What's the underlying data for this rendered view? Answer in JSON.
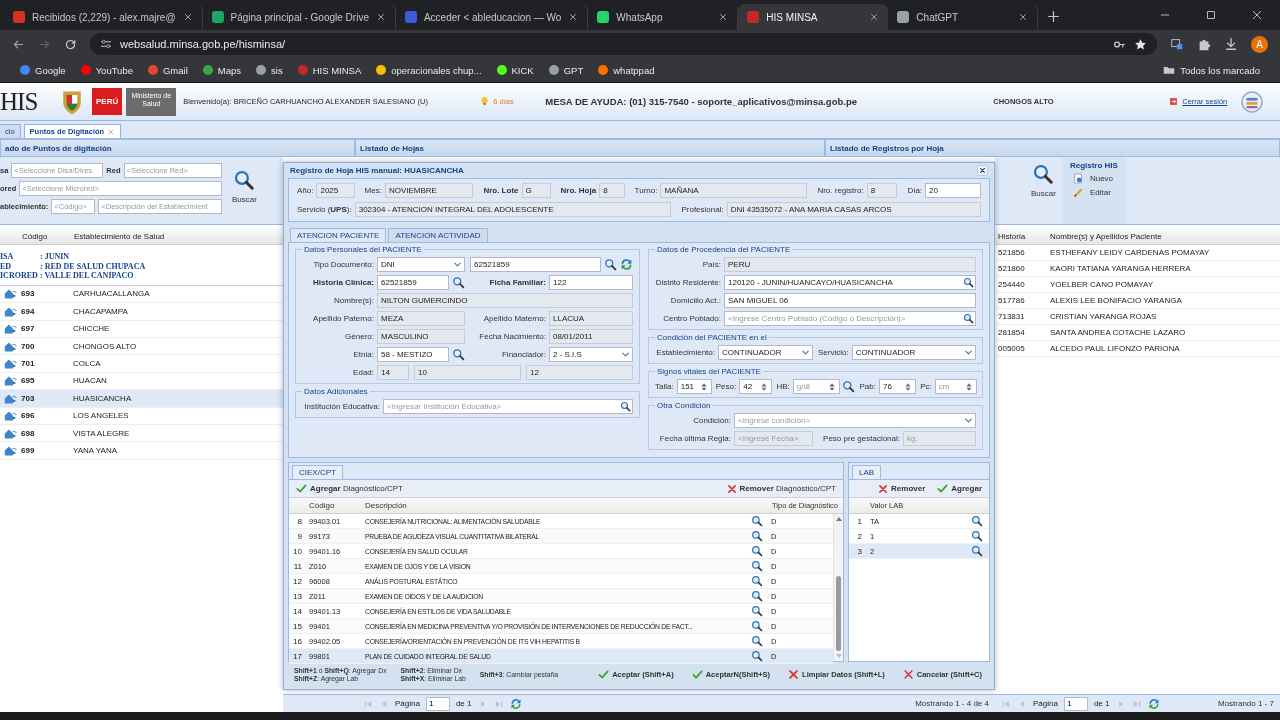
{
  "browser": {
    "tabs": [
      {
        "title": "Recibidos (2,229) - alex.majre@",
        "selected": false
      },
      {
        "title": "Página principal - Google Drive",
        "selected": false
      },
      {
        "title": "Acceder < ableducacion — Wo",
        "selected": false
      },
      {
        "title": "WhatsApp",
        "selected": false
      },
      {
        "title": "HIS MINSA",
        "selected": true
      },
      {
        "title": "ChatGPT",
        "selected": false
      }
    ],
    "url": "websalud.minsa.gob.pe/hisminsa/",
    "profile": "A",
    "bookmarks": [
      "Google",
      "YouTube",
      "Gmail",
      "Maps",
      "sis",
      "HIS MINSA",
      "operacionales chup...",
      "KICK",
      "GPT",
      "whatppad"
    ],
    "all_bookmarks": "Todos los marcado"
  },
  "app": {
    "logo": "HIS",
    "country": "PERÚ",
    "ministry": "Ministerio de Salud",
    "welcome": "Bienvenido(a): BRICEÑO CARHUANCHO ALEXANDER SALESIANO (U)",
    "alert": "6 días",
    "helpdesk": "MESA DE AYUDA: (01) 315-7540 - soporte_aplicativos@minsa.gob.pe",
    "establishment": "CHONGOS ALTO",
    "logout": "Cerrar sesión",
    "tabs": [
      {
        "label": "cio",
        "selected": false,
        "closable": false
      },
      {
        "label": "Puntos de Digitación",
        "selected": true,
        "closable": true
      }
    ],
    "panel_titles": [
      "ado de Puntos de digitación",
      "Listado de Hojas",
      "Listado de Registros por Hoja"
    ]
  },
  "points": {
    "filter_rows": [
      [
        {
          "label": "sa",
          "placeholder": "<Seleccione Disa/Dires."
        },
        {
          "label": "Red",
          "placeholder": "<Seleccione Red>"
        }
      ],
      [
        {
          "label": "ored",
          "placeholder": "<Seleccione Microred>"
        }
      ],
      [
        {
          "label": "ablecimiento:",
          "placeholder": "<Código>"
        },
        {
          "placeholder": "<Descripción del Establecimient"
        }
      ]
    ],
    "search": "Buscar",
    "columns": [
      "Código",
      "Establecimiento de Salud"
    ],
    "group": [
      {
        "label": "ISA",
        "value": ": JUNIN"
      },
      {
        "label": "ED",
        "value": ": RED DE SALUD CHUPACA"
      },
      {
        "label": "ICRORED",
        "value": ": VALLE DEL CANIPACO"
      }
    ],
    "rows": [
      {
        "code": "693",
        "name": "CARHUACALLANGA",
        "selected": false
      },
      {
        "code": "694",
        "name": "CHACAPAMPA",
        "selected": false
      },
      {
        "code": "697",
        "name": "CHICCHE",
        "selected": false
      },
      {
        "code": "700",
        "name": "CHONGOS ALTO",
        "selected": false
      },
      {
        "code": "701",
        "name": "COLCA",
        "selected": false
      },
      {
        "code": "695",
        "name": "HUACAN",
        "selected": false
      },
      {
        "code": "703",
        "name": "HUASICANCHA",
        "selected": true
      },
      {
        "code": "696",
        "name": "LOS ANGELES",
        "selected": false
      },
      {
        "code": "698",
        "name": "VISTA ALEGRE",
        "selected": false
      },
      {
        "code": "699",
        "name": "YANA YANA",
        "selected": false
      }
    ]
  },
  "registros": {
    "search": "Buscar",
    "group_title": "Registro HIS",
    "actions": [
      {
        "label": "Nuevo",
        "kind": "new"
      },
      {
        "label": "Editar",
        "kind": "edit"
      }
    ],
    "columns": [
      "Historia",
      "Nombre(s) y Apellidos Paciente"
    ],
    "rows": [
      {
        "historia": "521856",
        "name": "ESTHEFANY LEIDY CARDENAS POMAYAY"
      },
      {
        "historia": "521860",
        "name": "KAORI TATIANA YARANGA HERRERA"
      },
      {
        "historia": "254440",
        "name": "YOELBER CANO POMAYAY"
      },
      {
        "historia": "517786",
        "name": "ALEXIS LEE BONIFACIO YARANGA"
      },
      {
        "historia": "713831",
        "name": "CRISTIAN YARANGA ROJAS"
      },
      {
        "historia": "281854",
        "name": "SANTA ANDREA COTACHE LAZARO"
      },
      {
        "historia": "005005",
        "name": "ALCEDO PAUL LIFONZO PARIONA"
      }
    ]
  },
  "pagers": [
    {
      "page_label": "Página",
      "page": "1",
      "of": "de 1",
      "summary": "Mostrando 1 - 4 de 4"
    },
    {
      "page_label": "Página",
      "page": "1",
      "of": "de 1",
      "summary": "Mostrando 1 - 7"
    }
  ],
  "modal": {
    "title": "Registro de Hoja HIS manual: HUASICANCHA",
    "header_rows": [
      [
        {
          "label": "Año:",
          "value": "2025",
          "kind": "text",
          "readonly": true
        },
        {
          "label": "Mes:",
          "value": "NOVIEMBRE",
          "kind": "text",
          "readonly": true
        },
        {
          "label": "Nro. Lote",
          "value": "G",
          "kind": "text",
          "readonly": true,
          "bold": true
        },
        {
          "label": "Nro. Hoja",
          "value": "8",
          "kind": "text",
          "readonly": true,
          "bold": true
        },
        {
          "label": "Turno:",
          "value": "MAÑANA",
          "kind": "text",
          "readonly": true
        },
        {
          "label": "Nro. registro:",
          "value": "8",
          "kind": "text",
          "readonly": true
        },
        {
          "label": "Día:",
          "value": "20",
          "kind": "text",
          "readonly": false
        }
      ],
      [
        {
          "label": "Servicio (**UPS**):",
          "value": "302304 - ATENCION INTEGRAL DEL ADOLESCENTE",
          "kind": "text",
          "readonly": true
        },
        {
          "label": "Profesional:",
          "value": "DNI 43535072 - ANA MARIA CASAS ARCOS",
          "kind": "text",
          "readonly": true
        }
      ]
    ],
    "tabs": [
      {
        "label": "ATENCION PACIENTE",
        "selected": true
      },
      {
        "label": "ATENCION ACTIVIDAD",
        "selected": false
      }
    ],
    "patient_form": {
      "left": [
        {
          "title": "Datos Personales del PACIENTE",
          "rows": [
            [
              {
                "label": "Tipo Documento:",
                "value": "DNI",
                "kind": "select",
                "readonly": false
              },
              {
                "value": "62521859",
                "kind": "lookup_refresh",
                "readonly": false
              }
            ],
            [
              {
                "label": "Historia Clínica:",
                "value": "62521859",
                "kind": "lookup",
                "readonly": false,
                "bold": true
              },
              {
                "label": "Ficha Familiar:",
                "value": "122",
                "kind": "text",
                "readonly": false,
                "bold": true
              }
            ],
            [
              {
                "label": "Nombre(s):",
                "value": "NILTON GUMERCINDO",
                "kind": "text",
                "readonly": true
              }
            ],
            [
              {
                "label": "Apellido Paterno:",
                "value": "MEZA",
                "kind": "text",
                "readonly": true
              },
              {
                "label": "Apellido Materno:",
                "value": "LLACUA",
                "kind": "text",
                "readonly": true
              }
            ],
            [
              {
                "label": "Género:",
                "value": "MASCULINO",
                "kind": "text",
                "readonly": true
              },
              {
                "label": "Fecha Nacimiento:",
                "value": "08/01/2011",
                "kind": "text",
                "readonly": true
              }
            ],
            [
              {
                "label": "Etnia:",
                "value": "58 - MESTIZO",
                "kind": "search_button",
                "readonly": false
              },
              {
                "label": "Financiador:",
                "value": "2 - S.I.S",
                "kind": "select",
                "readonly": false
              }
            ],
            [
              {
                "label": "Edad:",
                "value": "14",
                "kind": "text",
                "readonly": true
              },
              {
                "value": "10",
                "kind": "text",
                "readonly": true
              },
              {
                "value": "12",
                "kind": "text",
                "readonly": true
              }
            ]
          ]
        },
        {
          "title": "Datos Adicionales",
          "rows": [
            [
              {
                "label": "Institución Educativa:",
                "placeholder": "<Ingresar Institución Educativa>",
                "kind": "search",
                "readonly": false
              }
            ]
          ]
        }
      ],
      "right": [
        {
          "title": "Datos de Procedencia del PACIENTE",
          "rows": [
            [
              {
                "label": "País:",
                "value": "PERU",
                "kind": "text",
                "readonly": true
              }
            ],
            [
              {
                "label": "Distrito Residente:",
                "value": "120120 - JUNIN/HUANCAYO/HUASICANCHA",
                "kind": "search",
                "readonly": false
              }
            ],
            [
              {
                "label": "Domicilio Act.:",
                "value": "SAN MIGUEL 06",
                "kind": "text",
                "readonly": false
              }
            ],
            [
              {
                "label": "Centro Poblado:",
                "placeholder": "<Ingrese Centro Poblado (Código o Descripción)>",
                "kind": "search",
                "readonly": false
              }
            ]
          ]
        },
        {
          "title": "Condición del PACIENTE en el",
          "rows": [
            [
              {
                "label": "Establecimiento:",
                "value": "CONTINUADOR",
                "kind": "select",
                "readonly": false
              },
              {
                "label": "Servicio:",
                "value": "CONTINUADOR",
                "kind": "select",
                "readonly": false
              }
            ]
          ]
        },
        {
          "title": "Signos vitales del PACIENTE",
          "rows": [
            [
              {
                "label": "Talla:",
                "value": "151",
                "kind": "spinner",
                "readonly": false
              },
              {
                "label": "Peso:",
                "value": "42",
                "kind": "spinner",
                "readonly": false
              },
              {
                "label": "HB:",
                "placeholder": "g/dl",
                "kind": "spinner_lookup",
                "readonly": false
              },
              {
                "label": "Pab:",
                "value": "76",
                "kind": "spinner",
                "readonly": false
              },
              {
                "label": "Pc:",
                "placeholder": "cm",
                "kind": "spinner",
                "readonly": false
              }
            ]
          ]
        },
        {
          "title": "Otra Condición",
          "rows": [
            [
              {
                "label": "Condición:",
                "placeholder": "<Ingrese condición>",
                "kind": "select",
                "readonly": false
              }
            ],
            [
              {
                "label": "Fecha última Regla:",
                "placeholder": "<Ingrese Fecha>",
                "kind": "text",
                "readonly": true
              },
              {
                "label": "Peso pre gestacional:",
                "placeholder": "kg.",
                "kind": "text",
                "readonly": true
              }
            ]
          ]
        }
      ]
    },
    "diagnosis": {
      "tab": "CIEX/CPT",
      "add": "**Agregar** Diagnóstico/CPT",
      "remove": "**Remover** Diagnóstico/CPT",
      "columns": [
        "Código",
        "Descripción",
        "Tipo de Diagnóstico"
      ],
      "rows": [
        {
          "n": "8",
          "code": "99403.01",
          "description": "CONSEJERÍA NUTRICIONAL: ALIMENTACIÓN SALUDABLE",
          "type": "D",
          "selected": false
        },
        {
          "n": "9",
          "code": "99173",
          "description": "PRUEBA DE AGUDEZA VISUAL CUANTITATIVA BILATERAL",
          "type": "D",
          "selected": false
        },
        {
          "n": "10",
          "code": "99401.16",
          "description": "CONSEJERÍA EN SALUD OCULAR",
          "type": "D",
          "selected": false
        },
        {
          "n": "11",
          "code": "Z010",
          "description": "EXAMEN DE OJOS Y DE LA VISION",
          "type": "D",
          "selected": false
        },
        {
          "n": "12",
          "code": "96008",
          "description": "ANÁLIS POSTURAL ESTÁTICO",
          "type": "D",
          "selected": false
        },
        {
          "n": "13",
          "code": "Z011",
          "description": "EXAMEN DE OIDOS Y DE LA AUDICION",
          "type": "D",
          "selected": false
        },
        {
          "n": "14",
          "code": "99401.13",
          "description": "CONSEJERÍA EN ESTILOS DE VIDA SALUDABLE",
          "type": "D",
          "selected": false
        },
        {
          "n": "15",
          "code": "99401",
          "description": "CONSEJERÍA EN MEDICINA PREVENTIVA Y/O PROVISIÓN DE INTERVENCIONES DE REDUCCIÓN DE FACT...",
          "type": "D",
          "selected": false
        },
        {
          "n": "16",
          "code": "99402.05",
          "description": "CONSEJERÍA/ORIENTACIÓN EN PREVENCIÓN DE ITS VIH HEPATITIS B",
          "type": "D",
          "selected": false
        },
        {
          "n": "17",
          "code": "99801",
          "description": "PLAN DE CUIDADO INTEGRAL DE SALUD",
          "type": "D",
          "selected": true
        }
      ]
    },
    "lab": {
      "tab": "LAB",
      "remove": "Remover",
      "add": "Agregar",
      "column": "Valor LAB",
      "rows": [
        {
          "n": "1",
          "value": "TA",
          "selected": false
        },
        {
          "n": "2",
          "value": "1",
          "selected": false
        },
        {
          "n": "3",
          "value": "2",
          "selected": true
        }
      ]
    },
    "shortcuts": [
      [
        "**Shift+1** ó **Shift+Q**: Agregar Dx",
        "**Shift+Z**: Agregar Lab"
      ],
      [
        "**Shift+2**: Eliminar Dx",
        "**Shift+X**: Eliminar Lab"
      ],
      [
        "**Shift+3**: Cambiar pestaña"
      ]
    ],
    "actions": [
      {
        "label": "Aceptar (Shift+A)",
        "kind": "accept"
      },
      {
        "label": "AceptarN(Shift+S)",
        "kind": "accept"
      },
      {
        "label": "Limpiar Datos (Shift+L)",
        "kind": "clear"
      },
      {
        "label": "Cancelar (Shift+C)",
        "kind": "cancel"
      }
    ]
  }
}
